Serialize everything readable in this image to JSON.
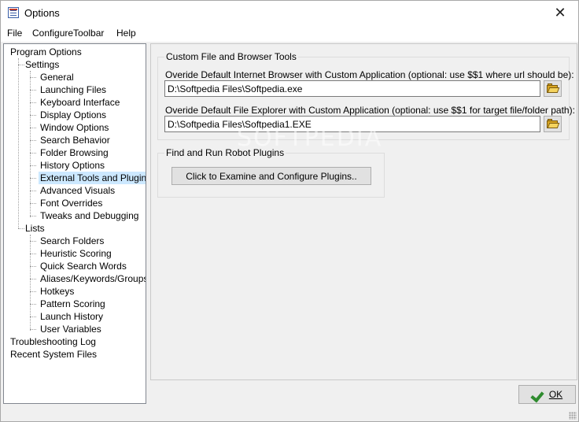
{
  "window": {
    "title": "Options",
    "close_glyph": "✕"
  },
  "menu": [
    "File",
    "ConfigureToolbar",
    "Help"
  ],
  "tree": {
    "root": "Program Options",
    "settings": {
      "label": "Settings",
      "items": [
        "General",
        "Launching Files",
        "Keyboard Interface",
        "Display Options",
        "Window Options",
        "Search Behavior",
        "Folder Browsing",
        "History Options",
        "External Tools and Plugins",
        "Advanced Visuals",
        "Font Overrides",
        "Tweaks and Debugging"
      ],
      "selected_index": 8
    },
    "lists": {
      "label": "Lists",
      "items": [
        "Search Folders",
        "Heuristic Scoring",
        "Quick Search Words",
        "Aliases/Keywords/Groups",
        "Hotkeys",
        "Pattern Scoring",
        "Launch History",
        "User Variables"
      ]
    },
    "extra": [
      "Troubleshooting Log",
      "Recent System Files"
    ]
  },
  "custom_tools": {
    "group_title": "Custom File and Browser Tools",
    "browser_label": "Overide Default Internet Browser with Custom Application (optional: use $$1 where url should be):",
    "browser_value": "D:\\Softpedia Files\\Softpedia.exe",
    "explorer_label": "Overide Default File Explorer with Custom Application (optional: use $$1 for target file/folder path):",
    "explorer_value": "D:\\Softpedia Files\\Softpedia1.EXE"
  },
  "plugins": {
    "group_title": "Find and Run Robot Plugins",
    "button_label": "Click to Examine and Configure Plugins.."
  },
  "footer": {
    "ok_label": "OK"
  },
  "watermark": "SOFTPEDIA",
  "colors": {
    "selection": "#cce8ff",
    "ok_check": "#2e8b2e",
    "folder": "#d9a520"
  }
}
